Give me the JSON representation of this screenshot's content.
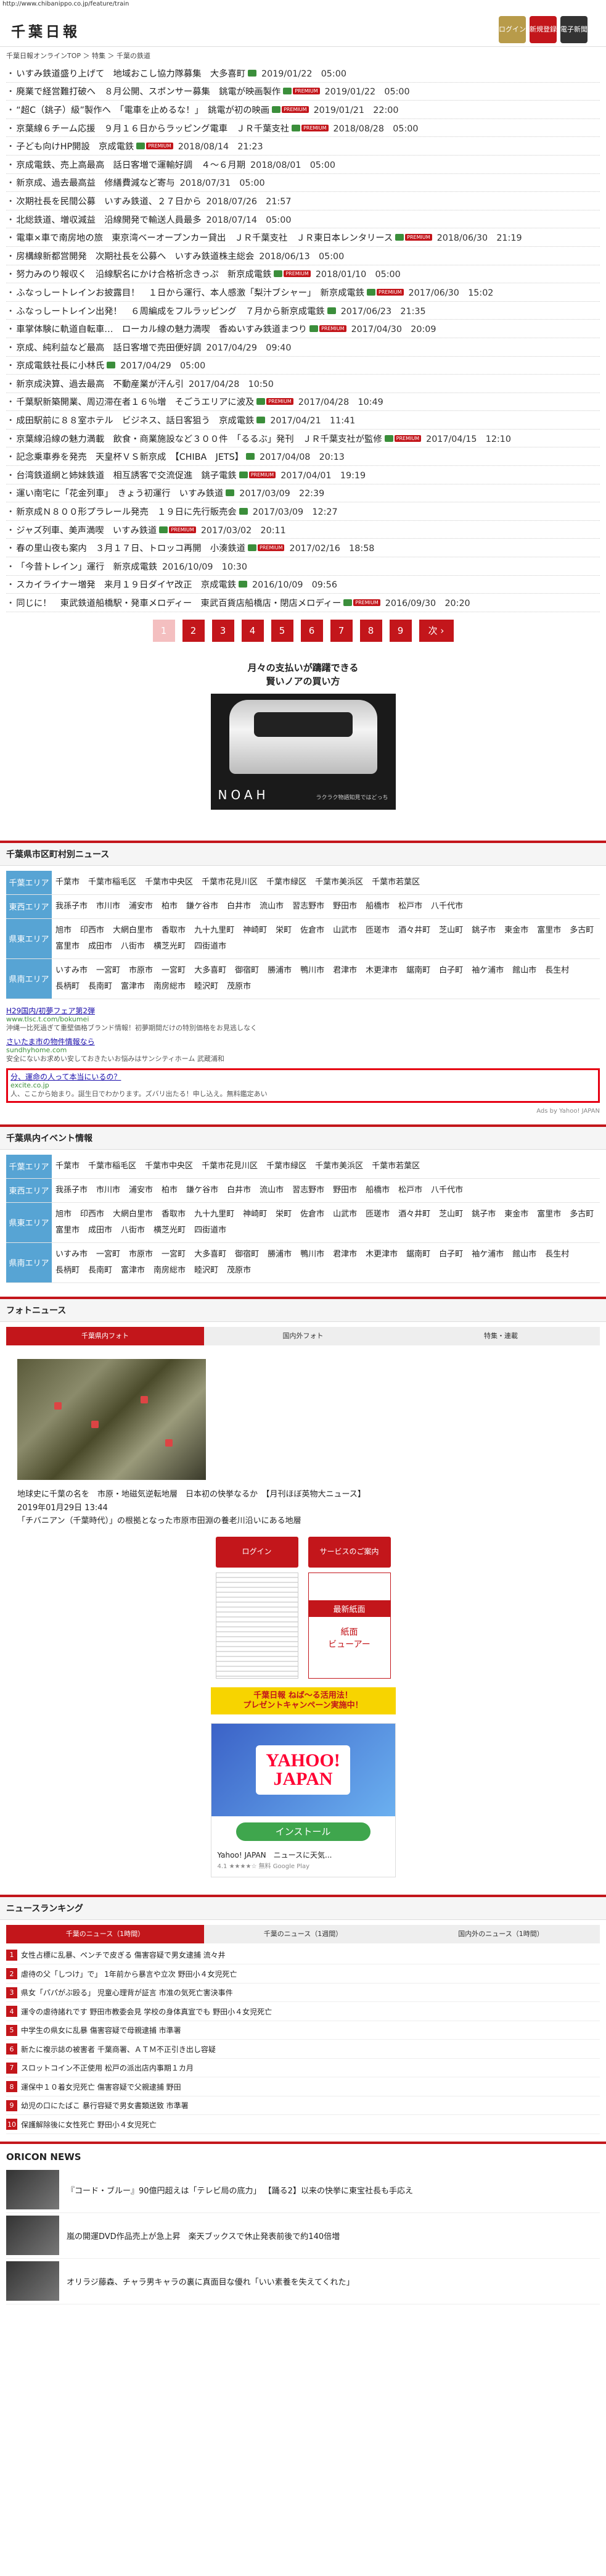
{
  "url": "http://www.chibanippo.co.jp/feature/train",
  "header": {
    "logo": "千葉日報",
    "buttons": [
      {
        "label": "ログイン"
      },
      {
        "label": "新規登録"
      },
      {
        "label": "電子新聞"
      }
    ]
  },
  "breadcrumb": "千葉日報オンラインTOP ＞ 特集 ＞ 千葉の鉄道",
  "news": [
    {
      "title": "いすみ鉄道盛り上げて　地域おこし協力隊募集　大多喜町",
      "cam": true,
      "prem": false,
      "date": "2019/01/22　05:00"
    },
    {
      "title": "廃業で経営難打破へ　８月公開、スポンサー募集　銚電が映画製作",
      "cam": true,
      "prem": true,
      "date": "2019/01/22　05:00"
    },
    {
      "title": "“超C（銚子）級”製作へ　「電車を止めるな！」　銚電が初の映画",
      "cam": true,
      "prem": true,
      "date": "2019/01/21　22:00"
    },
    {
      "title": "京葉線６チーム応援　９月１６日からラッピング電車　ＪＲ千葉支社",
      "cam": true,
      "prem": true,
      "date": "2018/08/28　05:00"
    },
    {
      "title": "子ども向けHP開設　京成電鉄",
      "cam": true,
      "prem": true,
      "date": "2018/08/14　21:23"
    },
    {
      "title": "京成電鉄、売上高最高　話日客増で運輸好調　４～６月期",
      "cam": false,
      "prem": false,
      "date": "2018/08/01　05:00"
    },
    {
      "title": "新京成、過去最高益　修繕費減など寄与",
      "cam": false,
      "prem": false,
      "date": "2018/07/31　05:00"
    },
    {
      "title": "次期社長を民間公募　いすみ鉄道、２７日から",
      "cam": false,
      "prem": false,
      "date": "2018/07/26　21:57"
    },
    {
      "title": "北総鉄道、増収減益　沿線開発で輸送人員最多",
      "cam": false,
      "prem": false,
      "date": "2018/07/14　05:00"
    },
    {
      "title": "電車×車で南房地の旅　東京湾ベーオープンカー貸出　ＪＲ千葉支社　ＪＲ東日本レンタリース",
      "cam": true,
      "prem": true,
      "date": "2018/06/30　21:19"
    },
    {
      "title": "房構線新都営開発　次期社長を公募へ　いすみ鉄道株主総会",
      "cam": false,
      "prem": false,
      "date": "2018/06/13　05:00"
    },
    {
      "title": "努力みのり報収く　沿線駅名にかけ合格祈念きっぷ　新京成電鉄",
      "cam": true,
      "prem": true,
      "date": "2018/01/10　05:00"
    },
    {
      "title": "ふなっしートレインお披露目！　１日から運行、本人感激「梨汁ブシャー」　新京成電鉄",
      "cam": true,
      "prem": true,
      "date": "2017/06/30　15:02"
    },
    {
      "title": "ふなっしートレイン出発！　６周編成をフルラッピング　７月から新京成電鉄",
      "cam": true,
      "prem": false,
      "date": "2017/06/23　21:35"
    },
    {
      "title": "車掌体験に軌道自転車…　ローカル線の魅力満喫　香ぬいすみ鉄道まつり",
      "cam": true,
      "prem": true,
      "date": "2017/04/30　20:09"
    },
    {
      "title": "京成、純利益など最高　話日客増で売田便好調",
      "cam": false,
      "prem": false,
      "date": "2017/04/29　09:40"
    },
    {
      "title": "京成電鉄社長に小林氏",
      "cam": true,
      "prem": false,
      "date": "2017/04/29　05:00"
    },
    {
      "title": "新京成決算、過去最高　不動産業が汗ん引",
      "cam": false,
      "prem": false,
      "date": "2017/04/28　10:50"
    },
    {
      "title": "千葉駅新築開業、周辺滞在者１６％増　そごうエリアに波及",
      "cam": true,
      "prem": true,
      "date": "2017/04/28　10:49"
    },
    {
      "title": "成田駅前に８８室ホテル　ビジネス、話日客狙う　京成電鉄",
      "cam": true,
      "prem": false,
      "date": "2017/04/21　11:41"
    },
    {
      "title": "京葉線沿線の魅力満載　飲食・商業施設など３００件　「るるぶ」発刊　ＪＲ千葉支社が監修",
      "cam": true,
      "prem": true,
      "date": "2017/04/15　12:10"
    },
    {
      "title": "記念乗車券を発売　天皇杯ＶＳ新京成　【CHIBA　JETS】",
      "cam": true,
      "prem": false,
      "date": "2017/04/08　20:13"
    },
    {
      "title": "台湾鉄道網と姉妹鉄道　相互誘客で交流促進　銚子電鉄",
      "cam": true,
      "prem": true,
      "date": "2017/04/01　19:19"
    },
    {
      "title": "運い南宅に「花金列車」　きょう初運行　いすみ鉄道",
      "cam": true,
      "prem": false,
      "date": "2017/03/09　22:39"
    },
    {
      "title": "新京成Ｎ８００形プラレール発売　１９日に先行販売会",
      "cam": true,
      "prem": false,
      "date": "2017/03/09　12:27"
    },
    {
      "title": "ジャズ列車、美声満喫　いすみ鉄道",
      "cam": true,
      "prem": true,
      "date": "2017/03/02　20:11"
    },
    {
      "title": "春の里山夜も案内　３月１７日、トロッコ再開　小湊鉄道",
      "cam": true,
      "prem": true,
      "date": "2017/02/16　18:58"
    },
    {
      "title": "「今昔トレイン」運行　新京成電鉄",
      "cam": false,
      "prem": false,
      "date": "2016/10/09　10:30"
    },
    {
      "title": "スカイライナー増発　来月１９日ダイヤ改正　京成電鉄",
      "cam": true,
      "prem": false,
      "date": "2016/10/09　09:56"
    },
    {
      "title": "同じに！　東武鉄道船橋駅・発車メロディー　東武百貨店船橋店・閉店メロディー",
      "cam": true,
      "prem": true,
      "date": "2016/09/30　20:20"
    }
  ],
  "pager": {
    "pages": [
      "1",
      "2",
      "3",
      "4",
      "5",
      "6",
      "7",
      "8",
      "9"
    ],
    "next": "次 ›"
  },
  "ad_noah": {
    "headline": "月々の支払いが躊躇できる\n賢いノアの買い方",
    "brand": "NOAH",
    "sub": "ラクラク物語知見ではどっち"
  },
  "city_news": {
    "title": "千葉県市区町村別ニュース",
    "areas": [
      {
        "label": "千葉エリア",
        "cities": [
          "千葉市",
          "千葉市稲毛区",
          "千葉市中央区",
          "千葉市花見川区",
          "千葉市緑区",
          "千葉市美浜区",
          "千葉市若葉区"
        ]
      },
      {
        "label": "東西エリア",
        "cities": [
          "我孫子市",
          "市川市",
          "浦安市",
          "柏市",
          "鎌ケ谷市",
          "白井市",
          "流山市",
          "習志野市",
          "野田市",
          "船橋市",
          "松戸市",
          "八千代市"
        ]
      },
      {
        "label": "県東エリア",
        "cities": [
          "旭市",
          "印西市",
          "大網白里市",
          "香取市",
          "九十九里町",
          "神崎町",
          "栄町",
          "佐倉市",
          "山武市",
          "匝瑳市",
          "酒々井町",
          "芝山町",
          "銚子市",
          "東金市",
          "富里市",
          "多古町",
          "富里市",
          "成田市",
          "八街市",
          "横芝光町",
          "四街道市"
        ]
      },
      {
        "label": "県南エリア",
        "cities": [
          "いすみ市",
          "一宮町",
          "市原市",
          "一宮町",
          "大多喜町",
          "御宿町",
          "勝浦市",
          "鴨川市",
          "君津市",
          "木更津市",
          "鋸南町",
          "白子町",
          "袖ケ浦市",
          "館山市",
          "長生村",
          "長柄町",
          "長南町",
          "富津市",
          "南房総市",
          "睦沢町",
          "茂原市"
        ]
      }
    ]
  },
  "sponsored": {
    "items": [
      {
        "title": "H29国内/初夢フェア第2弾",
        "url": "www.tlsc.t.com/bokumei",
        "desc": "沖縄一比死過ぎて重壁価格ブランド情報！初夢期間だけの特別価格をお見逃しなく"
      },
      {
        "title": "さいたま市の物件情報なら",
        "url": "sundhyhome.com",
        "desc": "安全にないお求めい安しておきたいお悩みはサンシティホーム 武蔵浦和"
      },
      {
        "title": "分、運命の人って本当にいるの？",
        "url": "excite.co.jp",
        "desc": "人、ここから始まり。誕生日でわかります。ズバリ出たる！申し込え。無料鑑定あい"
      }
    ],
    "ads_by": "Ads by Yahoo! JAPAN"
  },
  "event_news": {
    "title": "千葉県内イベント情報",
    "areas": [
      {
        "label": "千葉エリア",
        "cities": [
          "千葉市",
          "千葉市稲毛区",
          "千葉市中央区",
          "千葉市花見川区",
          "千葉市緑区",
          "千葉市美浜区",
          "千葉市若葉区"
        ]
      },
      {
        "label": "東西エリア",
        "cities": [
          "我孫子市",
          "市川市",
          "浦安市",
          "柏市",
          "鎌ケ谷市",
          "白井市",
          "流山市",
          "習志野市",
          "野田市",
          "船橋市",
          "松戸市",
          "八千代市"
        ]
      },
      {
        "label": "県東エリア",
        "cities": [
          "旭市",
          "印西市",
          "大網白里市",
          "香取市",
          "九十九里町",
          "神崎町",
          "栄町",
          "佐倉市",
          "山武市",
          "匝瑳市",
          "酒々井町",
          "芝山町",
          "銚子市",
          "東金市",
          "富里市",
          "多古町",
          "富里市",
          "成田市",
          "八街市",
          "横芝光町",
          "四街道市"
        ]
      },
      {
        "label": "県南エリア",
        "cities": [
          "いすみ市",
          "一宮町",
          "市原市",
          "一宮町",
          "大多喜町",
          "御宿町",
          "勝浦市",
          "鴨川市",
          "君津市",
          "木更津市",
          "鋸南町",
          "白子町",
          "袖ケ浦市",
          "館山市",
          "長生村",
          "長柄町",
          "長南町",
          "富津市",
          "南房総市",
          "睦沢町",
          "茂原市"
        ]
      }
    ]
  },
  "photo_news": {
    "title": "フォトニュース",
    "tabs": [
      "千葉県内フォト",
      "国内外フォト",
      "特集・連載"
    ],
    "caption": "地球史に千葉の名を　市原・地磁気逆転地層　日本初の快挙なるか　【月刊ほぼ英物大ニュース】",
    "date": "2019年01月29日 13:44",
    "lead": "「チバニアン（千葉時代）」の根拠となった市原市田淵の養老川沿いにある地層"
  },
  "side": {
    "login": "ログイン",
    "service": "サービスのご案内",
    "viewer_head": "最新紙面",
    "viewer_label": "紙面\nビューアー",
    "banner": "千葉日報 ねば～る活用法！\nプレゼントキャンペーン実施中！"
  },
  "ad_yahoo": {
    "logo": "YAHOO!\nJAPAN",
    "install": "インストール",
    "text": "Yahoo! JAPAN　ニュースに天気...",
    "stars": "4.1 ★★★★☆ 無料 Google Play"
  },
  "ranking": {
    "title": "ニュースランキング",
    "tabs": [
      "千葉のニュース（1時間）",
      "千葉のニュース（1週間）",
      "国内外のニュース（1時間）"
    ],
    "items": [
      "女性占標に乱暴、ペンチで皮ぎる 傷害容疑で男女逮捕 流々井",
      "虐待の父「しつけ」で」 1年前から暴言や立次 野田小４女児死亡",
      "県女「パパがぶ殴る」 児童心理背が証言 市准の気死亡害決事件",
      "運令の虐待諸れです 野田市教委会見 学校の身体真宣でも 野田小４女児死亡",
      "中学生の県女に乱暴 傷害容疑で母親逮捕 市準署",
      "新たに複示誌の被害者 千葉商署、ＡＴＭ不正引き出し容疑",
      "スロットコイン不正使用 松戸の派出店内事期１カ月",
      "運保中１０着女児死亡 傷害容疑で父親逮捕 野田",
      "幼児の口にたばこ 暴行容疑で男女書類送致 市準署",
      "保護解除後に女性死亡 野田小４女児死亡"
    ]
  },
  "oricon": {
    "title": "ORICON NEWS",
    "items": [
      "『コード・ブルー』90億円超えは「テレビ局の底力」 【踊る2】以来の快挙に東宝社長も手応え",
      "嵐の開運DVD作品売上が急上昇　楽天ブックスで休止発表前後で約140倍増",
      "オリラジ藤森、チャラ男キャラの裏に真面目な優れ「いい素養を失えてくれた」"
    ]
  }
}
